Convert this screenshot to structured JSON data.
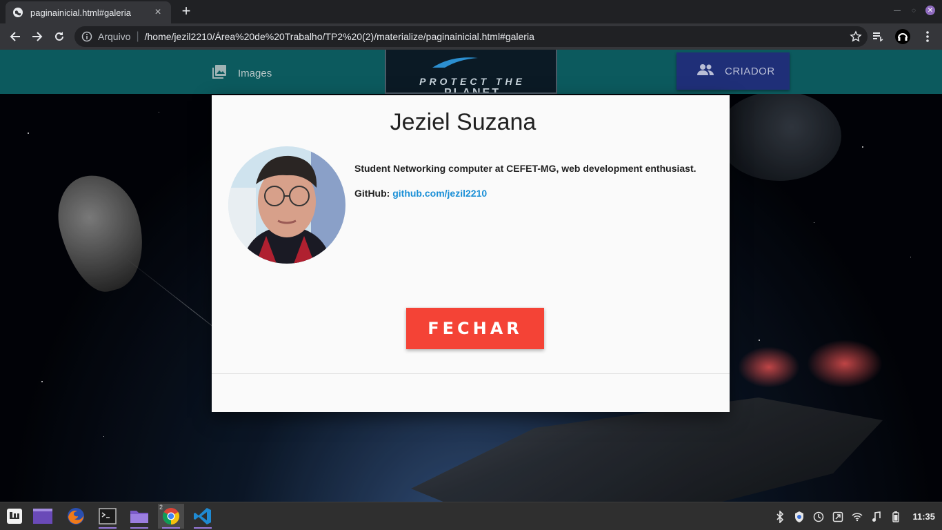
{
  "browser": {
    "tab_title": "paginainicial.html#galeria",
    "new_tab_label": "+",
    "close_tab_label": "×",
    "scheme_label": "Arquivo",
    "separator": "|",
    "url": "/home/jezil2210/Área%20de%20Trabalho/TP2%20(2)/materialize/paginainicial.html#galeria"
  },
  "navbar": {
    "images_label": "Images",
    "logo_line1": "PROTECT THE",
    "logo_line2": "PLANET",
    "criador_label": "CRIADOR"
  },
  "modal": {
    "title": "Jeziel Suzana",
    "bio": "Student Networking computer at CEFET-MG, web development enthusiast.",
    "github_prefix": "GitHub:",
    "github_link": "github.com/jezil2210",
    "close_button": "FECHAR"
  },
  "taskbar": {
    "chrome_badge": "2",
    "clock": "11:35"
  },
  "colors": {
    "navbar": "#0c5a5e",
    "criador_button": "#1f2f78",
    "close_button": "#f44336",
    "link": "#1a8fd6"
  }
}
